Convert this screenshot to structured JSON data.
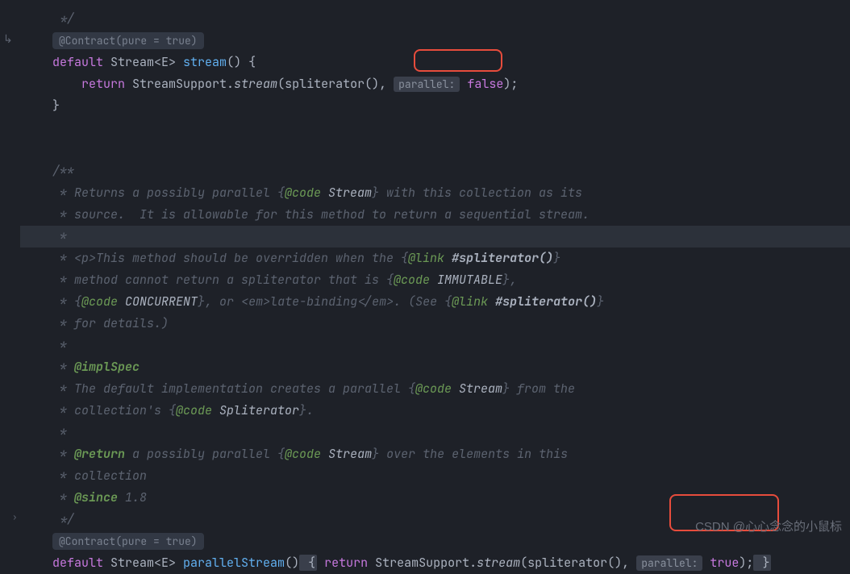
{
  "annotations": {
    "contract1": "@Contract(pure = true)",
    "contract2": "@Contract(pure = true)"
  },
  "hints": {
    "parallel1": "parallel:",
    "parallel2": "parallel:"
  },
  "code": {
    "comment_end": " */",
    "kw_default1": "default",
    "type_stream1": " Stream",
    "generic1": "<E>",
    "method_stream": " stream",
    "paren_open1": "()",
    "brace_open1": " {",
    "kw_return1": "return",
    "class_streamsupport1": " StreamSupport.",
    "method_streamcall1": "stream",
    "args_open1": "(",
    "method_spliterator1": "spliterator",
    "args_mid1": "(), ",
    "bool_false": " false",
    "args_close1": ")",
    "semi1": ";",
    "brace_close1": "}",
    "doc_start": "/**",
    "doc_line1": " * Returns a possibly parallel {",
    "doc_tag_code1": "@code",
    "doc_code1": " Stream",
    "doc_line1b": "} with this collection as its",
    "doc_line2": " * source.  It is allowable for this method to return a sequential stream.",
    "doc_empty": " *",
    "doc_line3a": " * ",
    "doc_ptag": "<p>",
    "doc_line3b": "This method should be overridden when the {",
    "doc_tag_link1": "@link",
    "doc_link1": " #spliterator()",
    "doc_line3c": "}",
    "doc_line4": " * method cannot return a spliterator that is {",
    "doc_tag_code2": "@code",
    "doc_code2": " IMMUTABLE",
    "doc_line4b": "},",
    "doc_line5a": " * {",
    "doc_tag_code3": "@code",
    "doc_code3": " CONCURRENT",
    "doc_line5b": "}, or ",
    "doc_emtag": "<em>",
    "doc_em_text": "late-binding",
    "doc_emclose": "</em>",
    "doc_line5c": ". (See {",
    "doc_tag_link2": "@link",
    "doc_link2": " #spliterator()",
    "doc_line5d": "}",
    "doc_line6": " * for details.)",
    "doc_line7": " * ",
    "doc_implspec": "@implSpec",
    "doc_line8": " * The default implementation creates a parallel {",
    "doc_tag_code4": "@code",
    "doc_code4": " Stream",
    "doc_line8b": "} from the",
    "doc_line9a": " * collection's {",
    "doc_tag_code5": "@code",
    "doc_code5": " Spliterator",
    "doc_line9b": "}.",
    "doc_line10": " * ",
    "doc_return": "@return",
    "doc_line10b": " a possibly parallel {",
    "doc_tag_code6": "@code",
    "doc_code6": " Stream",
    "doc_line10c": "} over the elements in this",
    "doc_line11": " * collection",
    "doc_line12": " * ",
    "doc_since": "@since",
    "doc_since_val": " 1.8",
    "doc_end": " */",
    "kw_default2": "default",
    "type_stream2": " Stream",
    "generic2": "<E>",
    "method_parallelstream": " parallelStream",
    "paren_open2": "()",
    "brace_open2": " {",
    "kw_return2": " return",
    "class_streamsupport2": " StreamSupport.",
    "method_streamcall2": "stream",
    "args_open2": "(",
    "method_spliterator2": "spliterator",
    "args_mid2": "(), ",
    "bool_true": " true",
    "args_close2": ")",
    "semi2": ";",
    "brace_close2": " }"
  },
  "watermark": "CSDN @心心念念的小鼠标"
}
